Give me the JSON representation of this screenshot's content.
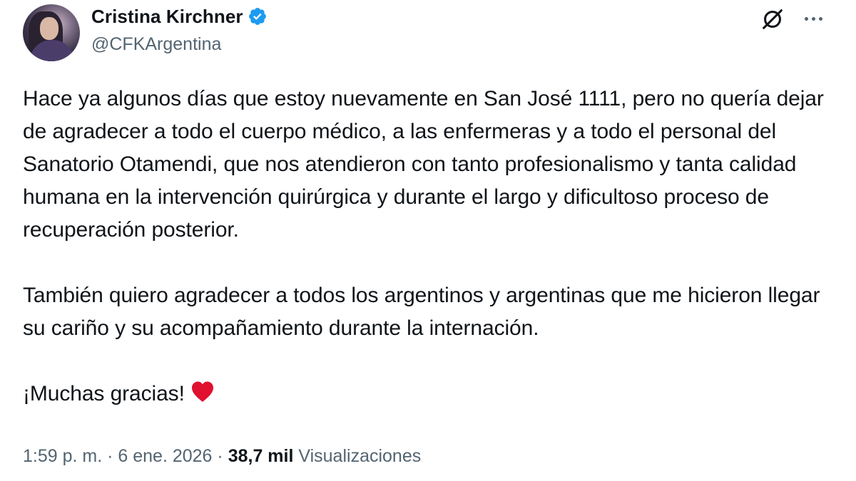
{
  "author": {
    "display_name": "Cristina Kirchner",
    "handle": "@CFKArgentina",
    "verified": true,
    "verified_color": "#1d9bf0"
  },
  "tweet": {
    "paragraphs": [
      "Hace ya algunos días que estoy nuevamente en San José 1111, pero no quería dejar de agradecer a todo el cuerpo médico, a las enfermeras y a todo el personal del Sanatorio Otamendi, que nos atendieron con tanto profesionalismo y tanta calidad humana en la intervención quirúrgica y durante el largo y dificultoso proceso de recuperación posterior.",
      "También quiero agradecer a todos los argentinos y argentinas que me hicieron llegar su cariño y su acompañamiento durante la internación.",
      "¡Muchas gracias!"
    ],
    "heart_emoji_color": "#e0102f"
  },
  "meta": {
    "time": "1:59 p. m.",
    "separator": " · ",
    "date": "6 ene. 2026",
    "views_count": "38,7 mil",
    "views_label": "Visualizaciones"
  },
  "icons": {
    "grok": "grok-icon",
    "more": "more-options-icon",
    "verified": "verified-badge-icon",
    "heart": "red-heart-icon"
  },
  "colors": {
    "text_primary": "#0f1419",
    "text_secondary": "#536471",
    "background": "#ffffff"
  }
}
